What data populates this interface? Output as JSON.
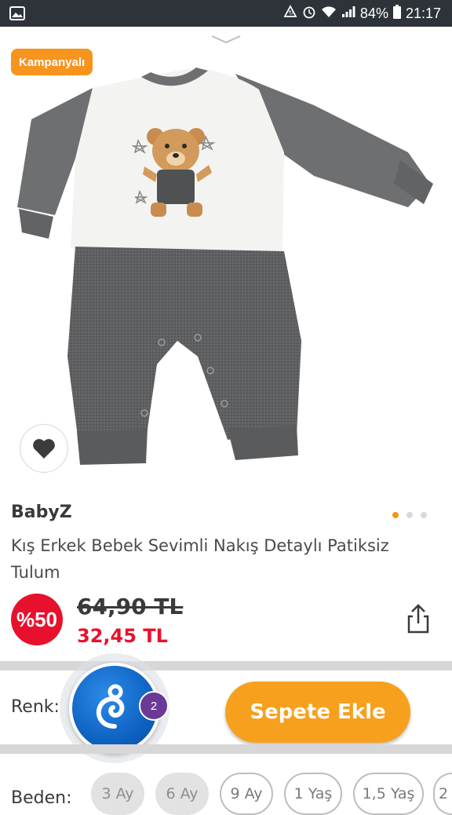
{
  "status_bar": {
    "battery": "84%",
    "time": "21:17",
    "icons": [
      "gallery-icon",
      "sync-icon",
      "alarm-icon",
      "wifi-icon",
      "signal-icon",
      "battery-icon"
    ]
  },
  "product": {
    "badge": "Kampanyalı",
    "brand": "BabyZ",
    "title": "Kış Erkek Bebek Sevimli Nakış Detaylı Patiksiz Tulum",
    "discount": "%50",
    "old_price": "64,90 TL",
    "new_price": "32,45 TL",
    "image_count": 3,
    "active_image": 1
  },
  "options": {
    "renk_label": "Renk:",
    "beden_label": "Beden:",
    "sizes": [
      {
        "label": "3 Ay",
        "available": false
      },
      {
        "label": "6 Ay",
        "available": false
      },
      {
        "label": "9 Ay",
        "available": true
      },
      {
        "label": "1 Yaş",
        "available": true
      },
      {
        "label": "1,5 Yaş",
        "available": true
      },
      {
        "label": "2",
        "available": true
      }
    ]
  },
  "actions": {
    "add_to_cart": "Sepete Ekle"
  },
  "assistant": {
    "notification_count": "2"
  },
  "colors": {
    "accent": "#f7a01d",
    "sale_red": "#e8112d",
    "status_bar": "#2d3338",
    "assistant_blue": "#0e62c2",
    "badge_purple": "#6a3a96"
  }
}
